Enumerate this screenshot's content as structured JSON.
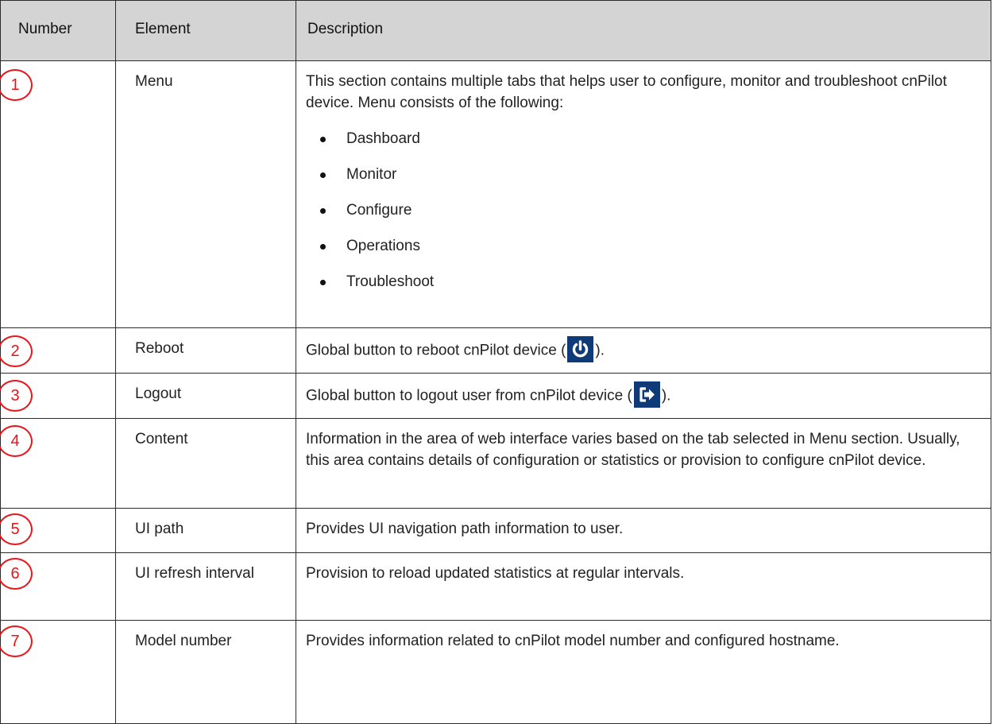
{
  "table": {
    "headers": {
      "number": "Number",
      "element": "Element",
      "description": "Description"
    },
    "rows": [
      {
        "number": "1",
        "element": "Menu",
        "description": "This section contains multiple tabs that helps user to configure, monitor and troubleshoot cnPilot device. Menu consists of the following:",
        "items": [
          "Dashboard",
          "Monitor",
          "Configure",
          "Operations",
          "Troubleshoot"
        ]
      },
      {
        "number": "2",
        "element": "Reboot",
        "description_before": "Global button to reboot cnPilot device (",
        "description_after": ").",
        "icon": "power-icon"
      },
      {
        "number": "3",
        "element": "Logout",
        "description_before": "Global button to logout user from cnPilot device (",
        "description_after": ").",
        "icon": "logout-icon"
      },
      {
        "number": "4",
        "element": "Content",
        "description": "Information in the area of web interface varies based on the tab selected in Menu section. Usually, this area contains details of configuration or statistics or provision to configure cnPilot device."
      },
      {
        "number": "5",
        "element": "UI path",
        "description": "Provides UI navigation path information to user."
      },
      {
        "number": "6",
        "element": "UI refresh interval",
        "description": "Provision to reload updated statistics at regular intervals."
      },
      {
        "number": "7",
        "element": "Model number",
        "description": "Provides information related to cnPilot model number and configured hostname."
      }
    ]
  },
  "colors": {
    "header_bg": "#d4d4d4",
    "circle_red": "#e8141a",
    "icon_bg": "#0e3a78"
  }
}
